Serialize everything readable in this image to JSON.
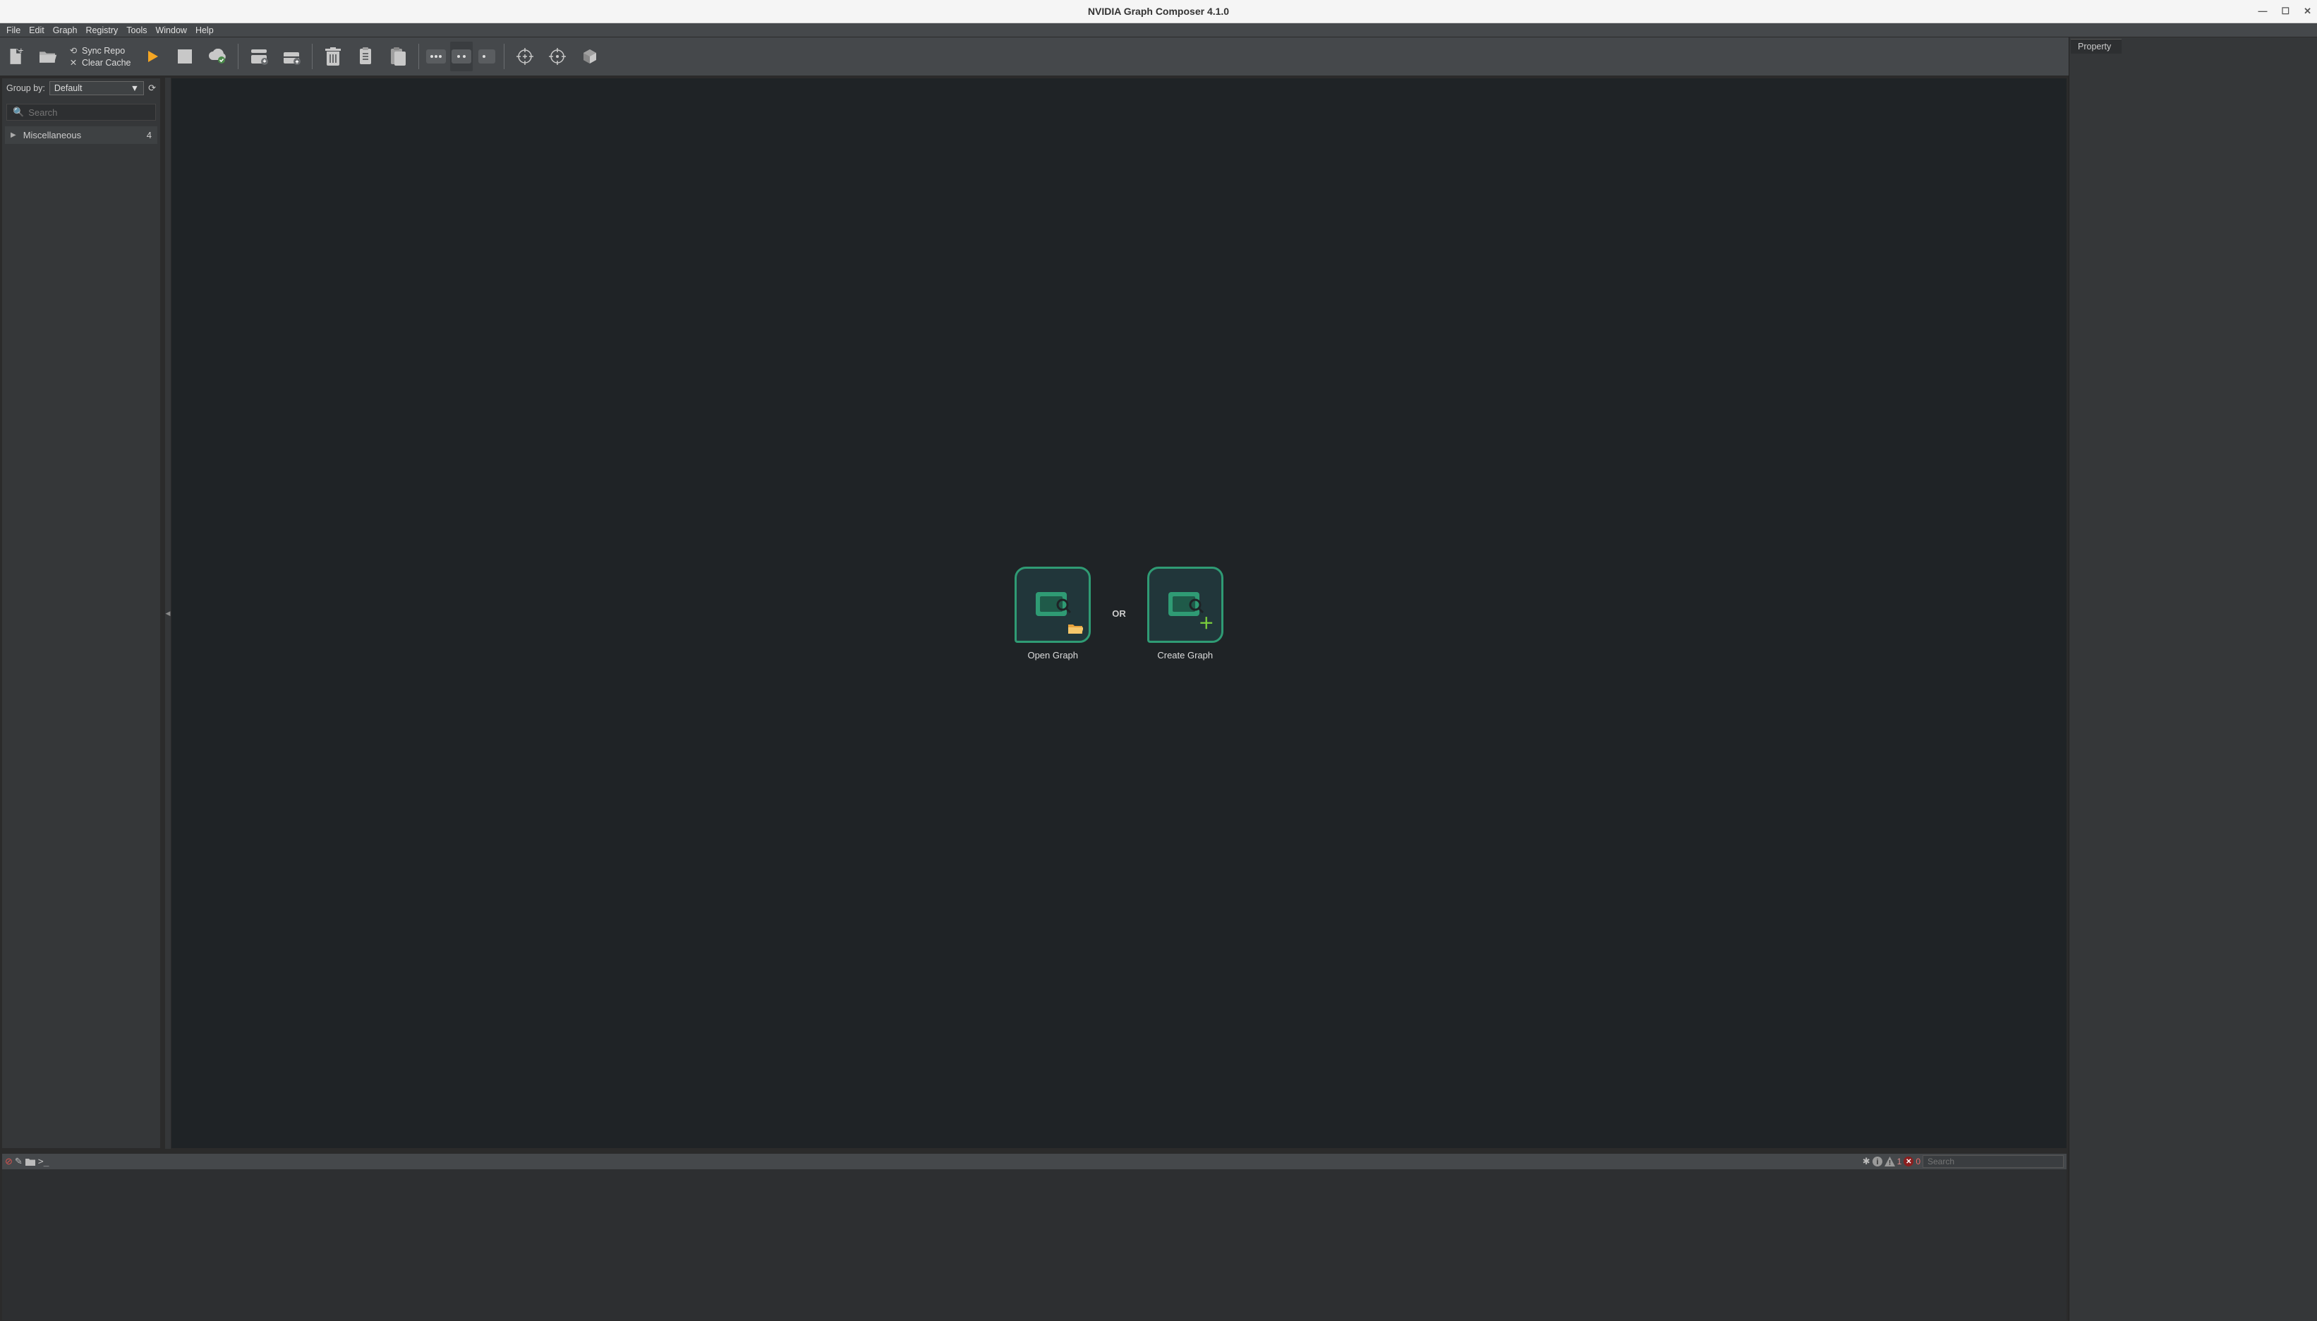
{
  "title": "NVIDIA Graph Composer 4.1.0",
  "menubar": {
    "items": [
      "File",
      "Edit",
      "Graph",
      "Registry",
      "Tools",
      "Window",
      "Help"
    ]
  },
  "repo_menu": {
    "sync": "Sync Repo",
    "clear": "Clear Cache"
  },
  "sidebar": {
    "group_by_label": "Group by:",
    "group_by_value": "Default",
    "search_placeholder": "Search",
    "tree": [
      {
        "label": "Miscellaneous",
        "count": "4"
      }
    ]
  },
  "canvas": {
    "open_label": "Open Graph",
    "create_label": "Create Graph",
    "or": "OR"
  },
  "console": {
    "warn_count": "1",
    "err_count": "0",
    "search_placeholder": "Search"
  },
  "property_panel": {
    "tab": "Property"
  }
}
